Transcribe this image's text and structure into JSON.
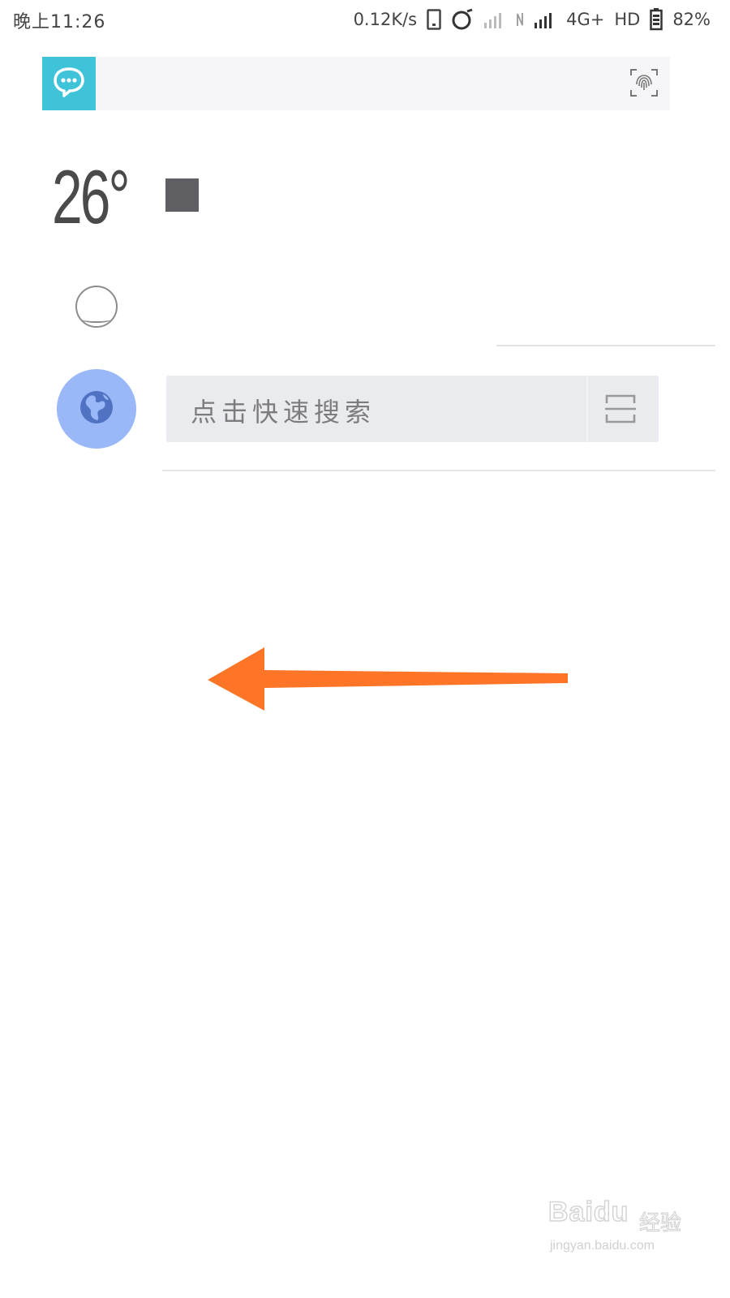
{
  "status_bar": {
    "time": "晚上11:26",
    "net_speed": "0.12K/s",
    "network_type": "4G+",
    "hd_label": "HD",
    "battery": "82%"
  },
  "weather": {
    "temperature": "26°"
  },
  "search": {
    "placeholder": "点击快速搜索"
  },
  "watermark": {
    "logo": "Baidu",
    "cn": "经验",
    "url": "jingyan.baidu.com"
  },
  "colors": {
    "chat_accent": "#3ec3d8",
    "globe_accent": "#9ab8f8",
    "arrow": "#ff7528"
  }
}
